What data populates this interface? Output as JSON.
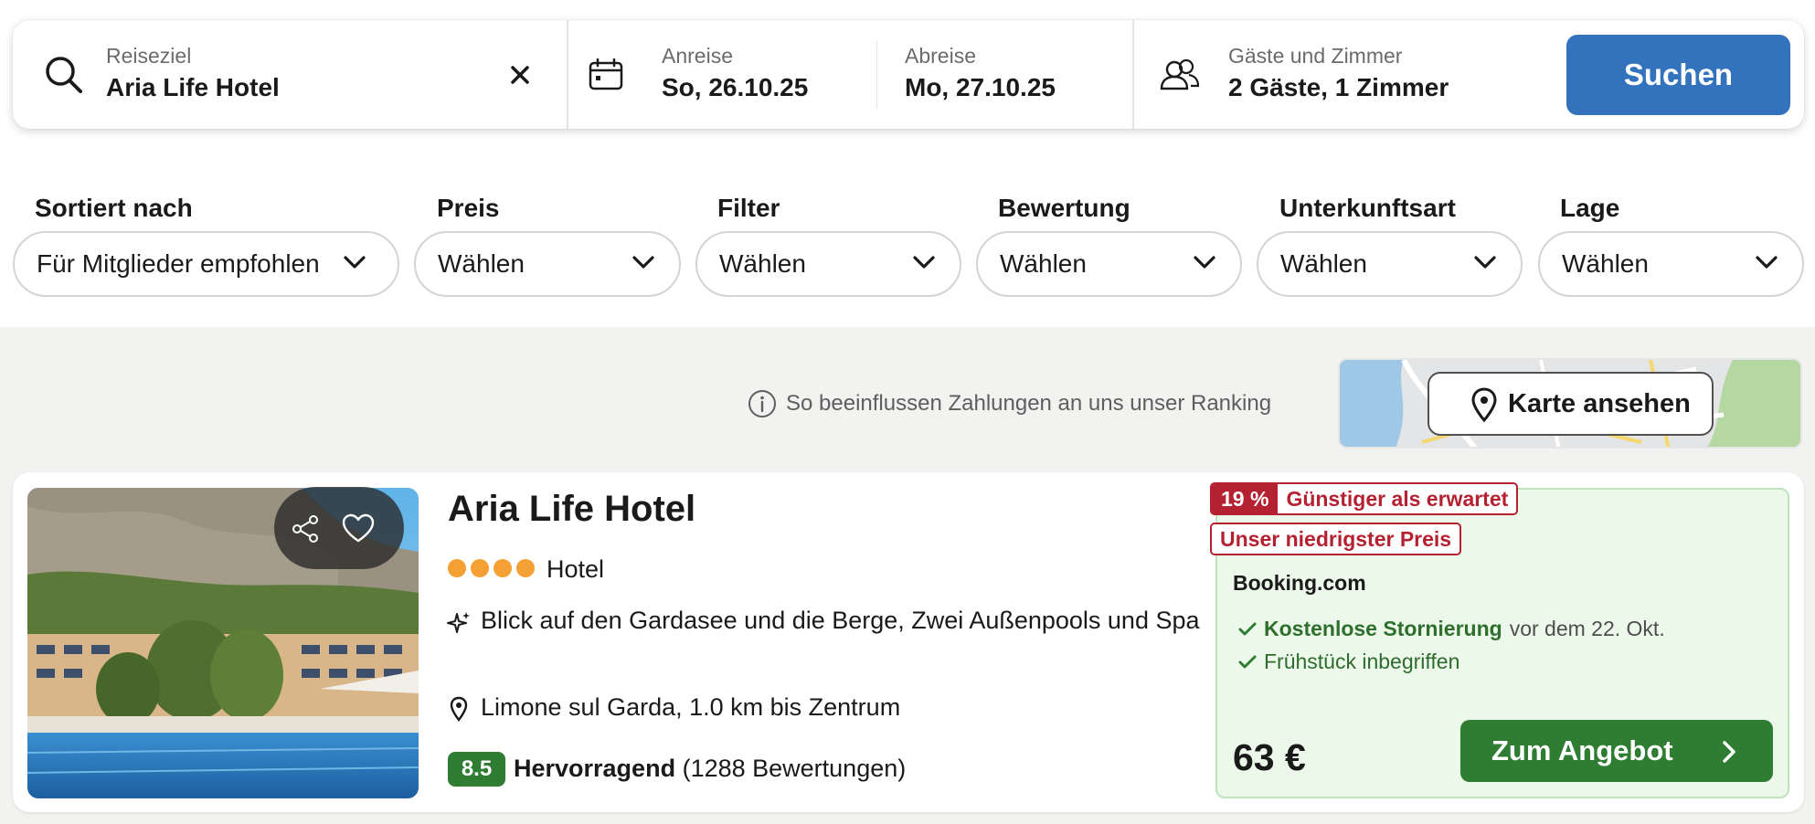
{
  "search": {
    "destination_label": "Reiseziel",
    "destination_value": "Aria Life Hotel",
    "checkin_label": "Anreise",
    "checkin_value": "So, 26.10.25",
    "checkout_label": "Abreise",
    "checkout_value": "Mo, 27.10.25",
    "guests_label": "Gäste und Zimmer",
    "guests_value": "2 Gäste, 1 Zimmer",
    "search_button": "Suchen",
    "icons": [
      "search-icon",
      "clear-icon",
      "calendar-icon",
      "guests-icon"
    ]
  },
  "filters": [
    {
      "label": "Sortiert nach",
      "value": "Für Mitglieder empfohlen"
    },
    {
      "label": "Preis",
      "value": "Wählen"
    },
    {
      "label": "Filter",
      "value": "Wählen"
    },
    {
      "label": "Bewertung",
      "value": "Wählen"
    },
    {
      "label": "Unterkunftsart",
      "value": "Wählen"
    },
    {
      "label": "Lage",
      "value": "Wählen"
    }
  ],
  "ranking_info": "So beeinflussen Zahlungen an uns unser Ranking",
  "map_button": "Karte ansehen",
  "hotel": {
    "name": "Aria Life Hotel",
    "star_count": 4,
    "type": "Hotel",
    "feature": "Blick auf den Gardasee und die Berge, Zwei Außenpools und Spa",
    "location": "Limone sul Garda, 1.0 km bis Zentrum",
    "rating_score": "8.5",
    "rating_word": "Hervorragend",
    "rating_count": "(1288 Bewertungen)"
  },
  "offer": {
    "discount_pct": "19 %",
    "discount_text": "Günstiger als erwartet",
    "lowest_price_tag": "Unser niedrigster Preis",
    "provider": "Booking.com",
    "perk1_bold": "Kostenlose Stornierung",
    "perk1_rest": "vor dem 22. Okt.",
    "perk2": "Frühstück inbegriffen",
    "price": "63 €",
    "deal_button": "Zum Angebot"
  },
  "colors": {
    "primary_blue": "#3373bd",
    "deal_green": "#2e7d32",
    "tag_red": "#b42232",
    "star_orange": "#f4a034",
    "offer_bg": "#ecf8ea"
  }
}
